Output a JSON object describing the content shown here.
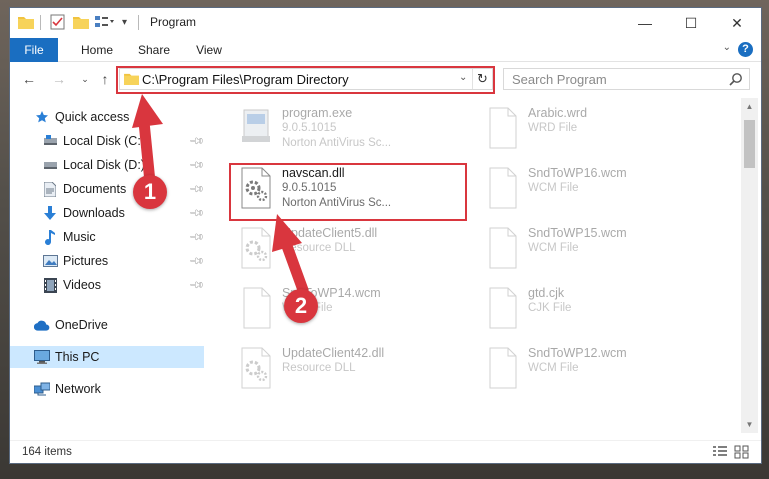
{
  "window": {
    "title": "Program",
    "controls": {
      "minimize": "—",
      "maximize": "☐",
      "close": "✕"
    }
  },
  "ribbon": {
    "tabs": [
      "File",
      "Home",
      "Share",
      "View"
    ],
    "help": "?"
  },
  "address_bar": {
    "path": "C:\\Program Files\\Program Directory",
    "search_placeholder": "Search Program"
  },
  "sidebar": {
    "items": [
      {
        "label": "Quick access",
        "icon": "star-icon"
      },
      {
        "label": "Local Disk (C:)",
        "icon": "drive-icon",
        "pinned": true
      },
      {
        "label": "Local Disk (D:)",
        "icon": "drive-icon",
        "pinned": true
      },
      {
        "label": "Documents",
        "icon": "documents-icon",
        "pinned": true
      },
      {
        "label": "Downloads",
        "icon": "downloads-icon",
        "pinned": true
      },
      {
        "label": "Music",
        "icon": "music-icon",
        "pinned": true
      },
      {
        "label": "Pictures",
        "icon": "pictures-icon",
        "pinned": true
      },
      {
        "label": "Videos",
        "icon": "videos-icon",
        "pinned": true
      },
      {
        "label": "OneDrive",
        "icon": "cloud-icon"
      },
      {
        "label": "This PC",
        "icon": "computer-icon",
        "selected": true
      },
      {
        "label": "Network",
        "icon": "network-icon"
      }
    ]
  },
  "files": [
    {
      "name": "program.exe",
      "line1": "9.0.5.1015",
      "line2": "Norton AntiVirus Sc...",
      "icon": "exe-file-icon",
      "faded": true
    },
    {
      "name": "Arabic.wrd",
      "line1": "WRD File",
      "line2": "",
      "icon": "blank-file-icon",
      "faded": true
    },
    {
      "name": "navscan.dll",
      "line1": "9.0.5.1015",
      "line2": "Norton AntiVirus Sc...",
      "icon": "dll-gear-file-icon",
      "faded": false
    },
    {
      "name": "SndToWP16.wcm",
      "line1": "WCM File",
      "line2": "",
      "icon": "blank-file-icon",
      "faded": true
    },
    {
      "name": "UpdateClient5.dll",
      "line1": "Resource DLL",
      "line2": "",
      "icon": "dll-gear-file-icon",
      "faded": true
    },
    {
      "name": "SndToWP15.wcm",
      "line1": "WCM File",
      "line2": "",
      "icon": "blank-file-icon",
      "faded": true
    },
    {
      "name": "SndToWP14.wcm",
      "line1": "WCM File",
      "line2": "",
      "icon": "blank-file-icon",
      "faded": true
    },
    {
      "name": "gtd.cjk",
      "line1": "CJK File",
      "line2": "",
      "icon": "blank-file-icon",
      "faded": true
    },
    {
      "name": "UpdateClient42.dll",
      "line1": "Resource DLL",
      "line2": "",
      "icon": "dll-gear-file-icon",
      "faded": true
    },
    {
      "name": "SndToWP12.wcm",
      "line1": "WCM File",
      "line2": "",
      "icon": "blank-file-icon",
      "faded": true
    }
  ],
  "status": {
    "item_count": "164 items"
  },
  "annotations": {
    "step1": "1",
    "step2": "2"
  },
  "colors": {
    "accent": "#1a6ec1",
    "highlight": "#d9363e",
    "selection": "#cce8ff"
  }
}
